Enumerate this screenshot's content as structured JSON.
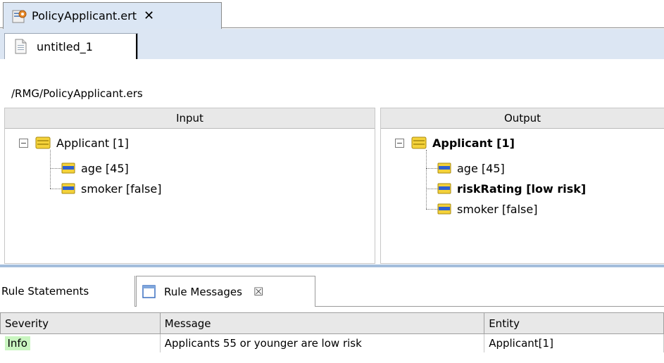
{
  "editor": {
    "tab_title": "PolicyApplicant.ert",
    "close_glyph": "✕"
  },
  "tests": {
    "tab_label": "untitled_1",
    "path": "/RMG/PolicyApplicant.ers"
  },
  "input": {
    "header": "Input",
    "entity": "Applicant [1]",
    "attributes": [
      "age [45]",
      "smoker [false]"
    ]
  },
  "output": {
    "header": "Output",
    "entity": "Applicant [1]",
    "attributes": [
      "age [45]",
      "riskRating [low risk]",
      "smoker [false]"
    ]
  },
  "views": {
    "rule_statements_label": "Rule Statements",
    "rule_messages_label": "Rule Messages",
    "close_glyph": "☒"
  },
  "messages": {
    "columns": [
      "Severity",
      "Message",
      "Entity"
    ],
    "rows": [
      {
        "severity": "Info",
        "message": "Applicants 55 or younger are low risk",
        "entity": "Applicant[1]"
      }
    ]
  },
  "colors": {
    "tab_blue": "#dbe6f4",
    "info_green": "#c9f5c0",
    "entity_yellow": "#f4d23a",
    "attr_blue": "#2e5fd0"
  },
  "icons": {
    "editor_tab": "ruletest-icon",
    "test_tab": "document-icon",
    "entity": "entity-icon",
    "attribute": "attribute-icon",
    "rule_messages": "window-icon"
  }
}
